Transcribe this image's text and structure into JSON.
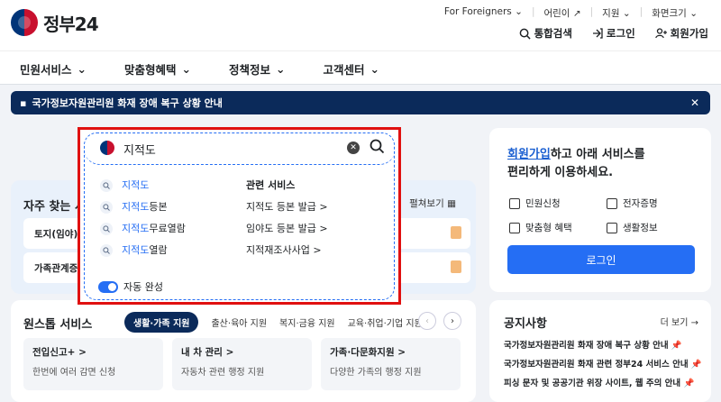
{
  "header": {
    "logo_text": "정부24",
    "utils": [
      "For Foreigners",
      "어린이",
      "지원",
      "화면크기"
    ],
    "actions": [
      "통합검색",
      "로그인",
      "회원가입"
    ]
  },
  "nav": [
    "민원서비스",
    "맞춤형혜택",
    "정책정보",
    "고객센터"
  ],
  "alert": {
    "text": "국가정보자원관리원 화재 장애 복구 상황 안내"
  },
  "search": {
    "value": "지적도",
    "suggestions": [
      {
        "hl": "지적도",
        "rest": ""
      },
      {
        "hl": "지적도",
        "rest": "등본"
      },
      {
        "hl": "지적도",
        "rest": "무료열람"
      },
      {
        "hl": "지적도",
        "rest": "열람"
      }
    ],
    "related_title": "관련 서비스",
    "related": [
      "지적도 등본 발급 >",
      "임야도 등본 발급 >",
      "지적재조사사업 >"
    ],
    "autocomplete_label": "자동 완성"
  },
  "freq": {
    "title": "자주 찾는 서",
    "more": "펼쳐보기",
    "rows": [
      "토지(임야)대",
      "가족관계증명"
    ]
  },
  "one_stop": {
    "title": "원스톱 서비스",
    "tabs": [
      "생활·가족 지원",
      "출산·육아 지원",
      "복지·금융 지원",
      "교육·취업·기업 지원"
    ],
    "tiles": [
      {
        "title": "전입신고+ >",
        "desc": "한번에 여러 감면 신청"
      },
      {
        "title": "내 차 관리 >",
        "desc": "자동차 관련 행정 지원"
      },
      {
        "title": "가족·다문화지원 >",
        "desc": "다양한 가족의 행정 지원"
      }
    ]
  },
  "login": {
    "link": "회원가입",
    "msg1": "하고 아래 서비스를",
    "msg2": "편리하게 이용하세요.",
    "quick": [
      "민원신청",
      "전자증명",
      "맞춤형 혜택",
      "생활정보"
    ],
    "button": "로그인"
  },
  "notice": {
    "title": "공지사항",
    "more": "더 보기 →",
    "items": [
      "국가정보자원관리원 화재 장애 복구 상황 안내",
      "국가정보자원관리원 화재 관련 정부24 서비스 안내",
      "피싱 문자 및 공공기관 위장 사이트, 웹 주의 안내"
    ]
  }
}
